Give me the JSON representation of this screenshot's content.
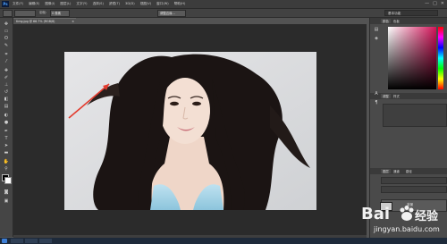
{
  "app": {
    "logo": "Ps"
  },
  "menu": [
    "文件(F)",
    "编辑(E)",
    "图像(I)",
    "图层(L)",
    "文字(Y)",
    "选择(S)",
    "滤镜(T)",
    "3D(D)",
    "视图(V)",
    "窗口(W)",
    "帮助(H)"
  ],
  "window_buttons": [
    "—",
    "□",
    "✕"
  ],
  "options": {
    "feather_label": "羽化:",
    "feather_value": "0 像素",
    "refine_label": "调整边缘...",
    "workspace": "基本功能"
  },
  "doc_tab": {
    "title": "timg.jpg @ 66.7% (RGB/8)",
    "close": "×"
  },
  "right": {
    "top_tabs": [
      "颜色",
      "色板"
    ],
    "mid_tabs": [
      "调整",
      "样式"
    ],
    "properties": [
      "W:",
      "H:",
      "X:",
      "Y:"
    ],
    "layer_tabs": [
      "图层",
      "通道",
      "路径"
    ],
    "layer_name": "背景"
  },
  "watermark": {
    "brand_left": "Bai",
    "brand_right": "经验",
    "url": "jingyan.baidu.com"
  },
  "colors": {
    "accent": "#3e7fd6",
    "arrow": "#e33b2e",
    "bg_dark": "#2b2b2b",
    "panel": "#4a4a4a"
  }
}
